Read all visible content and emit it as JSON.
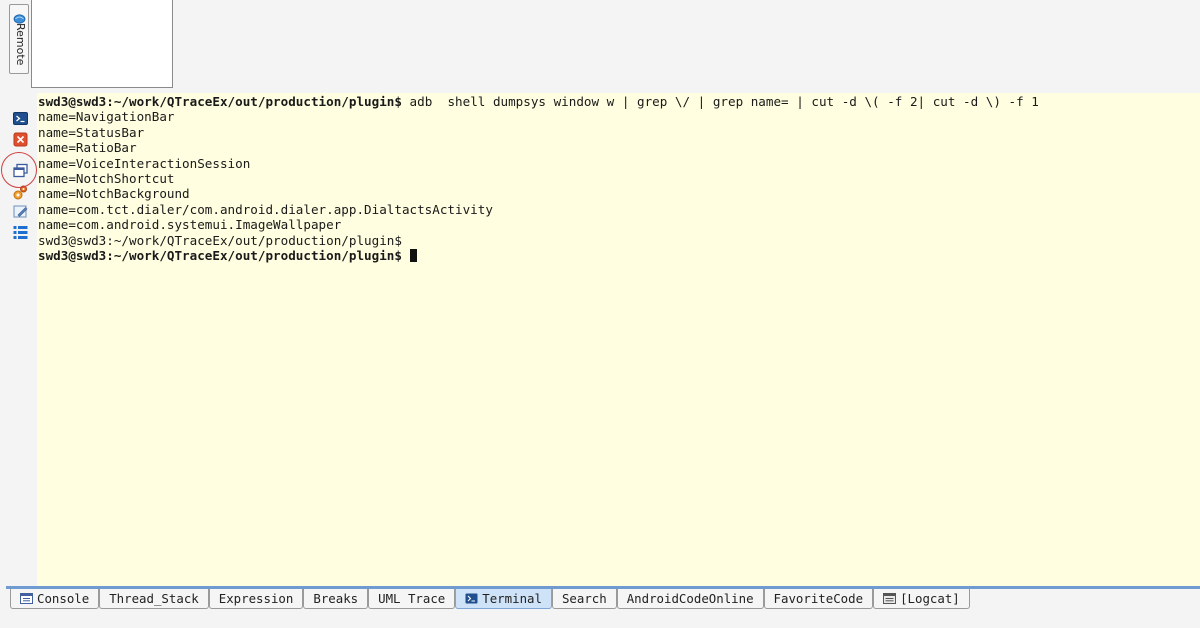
{
  "remote": {
    "label": "Remote",
    "icon": "remote-globe-icon"
  },
  "side_toolbar": {
    "items": [
      {
        "name": "terminal-icon"
      },
      {
        "name": "close-terminal-icon"
      },
      {
        "name": "new-window-icon"
      },
      {
        "name": "settings-icon"
      },
      {
        "name": "edit-icon"
      },
      {
        "name": "list-icon"
      }
    ]
  },
  "terminal": {
    "lines": [
      {
        "prompt": "swd3@swd3:~/work/QTraceEx/out/production/plugin$",
        "text": " adb  shell dumpsys window w | grep \\/ | grep name= | cut -d \\( -f 2| cut -d \\) -f 1",
        "bold": true
      },
      {
        "prompt": "",
        "text": "name=NavigationBar",
        "bold": false
      },
      {
        "prompt": "",
        "text": "name=StatusBar",
        "bold": false
      },
      {
        "prompt": "",
        "text": "name=RatioBar",
        "bold": false
      },
      {
        "prompt": "",
        "text": "name=VoiceInteractionSession",
        "bold": false
      },
      {
        "prompt": "",
        "text": "name=NotchShortcut",
        "bold": false
      },
      {
        "prompt": "",
        "text": "name=NotchBackground",
        "bold": false
      },
      {
        "prompt": "",
        "text": "name=com.tct.dialer/com.android.dialer.app.DialtactsActivity",
        "bold": false
      },
      {
        "prompt": "",
        "text": "name=com.android.systemui.ImageWallpaper",
        "bold": false
      },
      {
        "prompt": "",
        "text": "swd3@swd3:~/work/QTraceEx/out/production/plugin$",
        "bold": false
      },
      {
        "prompt": "swd3@swd3:~/work/QTraceEx/out/production/plugin$",
        "text": " ",
        "bold": true,
        "cursor": true
      }
    ]
  },
  "tabs": {
    "items": [
      {
        "label": "Console",
        "icon": "console-icon",
        "active": false
      },
      {
        "label": "Thread_Stack",
        "icon": "",
        "active": false
      },
      {
        "label": "Expression",
        "icon": "",
        "active": false
      },
      {
        "label": "Breaks",
        "icon": "",
        "active": false
      },
      {
        "label": "UML Trace",
        "icon": "",
        "active": false
      },
      {
        "label": "Terminal",
        "icon": "terminal-icon",
        "active": true
      },
      {
        "label": "Search",
        "icon": "",
        "active": false
      },
      {
        "label": "AndroidCodeOnline",
        "icon": "",
        "active": false
      },
      {
        "label": "FavoriteCode",
        "icon": "",
        "active": false
      },
      {
        "label": "[Logcat]",
        "icon": "logcat-icon",
        "active": false
      }
    ]
  },
  "colors": {
    "terminal_bg": "#fffee0",
    "active_tab_bg": "#cfe3f8",
    "tab_underline": "#6f9bd0"
  }
}
